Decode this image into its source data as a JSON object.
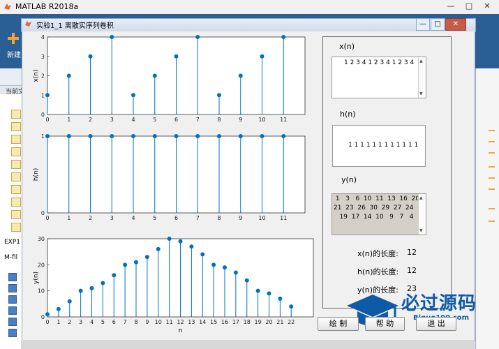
{
  "matlab": {
    "title": "MATLAB R2018a",
    "new_label": "新建",
    "curdir_label": "当前文",
    "exp_label": "EXP1",
    "mfile_label": "M-fil"
  },
  "figure": {
    "title": "实验1_1   离散实序列卷积",
    "minimize": "—",
    "maximize": "□",
    "close": "✕"
  },
  "panel": {
    "xn_label": "x(n)",
    "xn_value": "1 2 3 4 1 2 3 4 1 2 3 4",
    "hn_label": "h(n)",
    "hn_value": "1 1 1 1 1 1 1 1 1 1 1 1",
    "yn_label": "y(n)",
    "yn_rows": [
      " 1   3   6  10  11  13  16  20",
      "21  23  26  30  29  27  24  20",
      "   19  17  14  10   9   7   4"
    ],
    "xn_len_label": "x(n)的长度:",
    "xn_len_value": "12",
    "hn_len_label": "h(n)的长度:",
    "hn_len_value": "12",
    "yn_len_label": "y(n)的长度:",
    "yn_len_value": "23"
  },
  "buttons": {
    "draw": "绘 制",
    "help": "帮 助",
    "exit": "退 出"
  },
  "watermark": {
    "main": "必过源码",
    "sub": "Biguo100.com"
  },
  "colors": {
    "stem": "#0072bd"
  },
  "chart_data": [
    {
      "type": "stem",
      "ylabel": "x(n)",
      "x": [
        0,
        1,
        2,
        3,
        4,
        5,
        6,
        7,
        8,
        9,
        10,
        11
      ],
      "values": [
        1,
        2,
        3,
        4,
        1,
        2,
        3,
        4,
        1,
        2,
        3,
        4
      ],
      "xlim": [
        0,
        12
      ],
      "ylim": [
        0,
        4
      ],
      "xticks": [
        0,
        1,
        2,
        3,
        4,
        5,
        6,
        7,
        8,
        9,
        10,
        11
      ],
      "yticks": [
        0,
        1,
        2,
        3,
        4
      ]
    },
    {
      "type": "stem",
      "ylabel": "h(n)",
      "x": [
        0,
        1,
        2,
        3,
        4,
        5,
        6,
        7,
        8,
        9,
        10,
        11
      ],
      "values": [
        1,
        1,
        1,
        1,
        1,
        1,
        1,
        1,
        1,
        1,
        1,
        1
      ],
      "xlim": [
        0,
        12
      ],
      "ylim": [
        0,
        1
      ],
      "xticks": [
        0,
        1,
        2,
        3,
        4,
        5,
        6,
        7,
        8,
        9,
        10,
        11
      ],
      "yticks": [
        0,
        1
      ]
    },
    {
      "type": "stem",
      "ylabel": "y(n)",
      "xlabel": "n",
      "x": [
        0,
        1,
        2,
        3,
        4,
        5,
        6,
        7,
        8,
        9,
        10,
        11,
        12,
        13,
        14,
        15,
        16,
        17,
        18,
        19,
        20,
        21,
        22
      ],
      "values": [
        1,
        3,
        6,
        10,
        11,
        13,
        16,
        20,
        21,
        23,
        26,
        30,
        29,
        27,
        24,
        20,
        19,
        17,
        14,
        10,
        9,
        7,
        4
      ],
      "xlim": [
        0,
        24
      ],
      "ylim": [
        0,
        30
      ],
      "xticks": [
        0,
        1,
        2,
        3,
        4,
        5,
        6,
        7,
        8,
        9,
        10,
        11,
        12,
        13,
        14,
        15,
        16,
        17,
        18,
        19,
        20,
        21,
        22
      ],
      "yticks": [
        0,
        10,
        20,
        30
      ]
    }
  ]
}
